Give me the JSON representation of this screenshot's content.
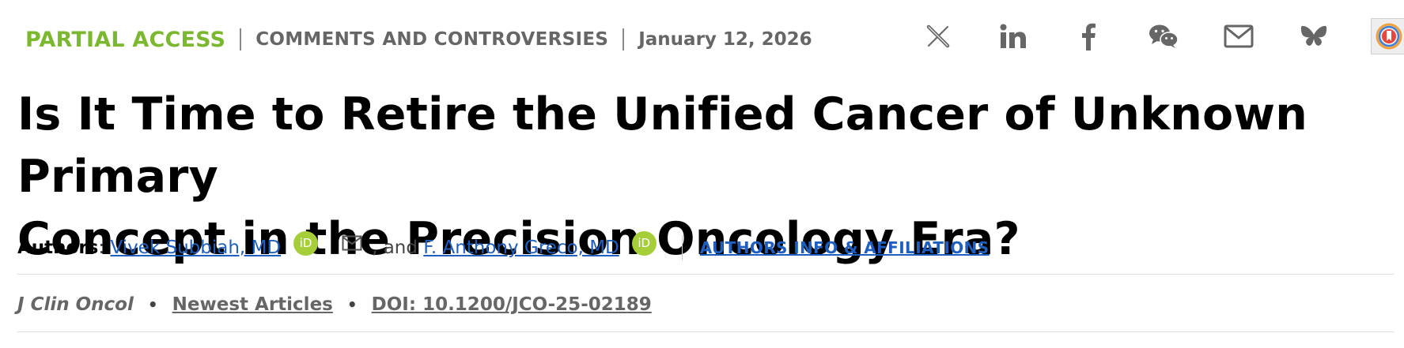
{
  "header": {
    "access_label": "PARTIAL ACCESS",
    "section_label": "COMMENTS AND CONTROVERSIES",
    "date": "January 12, 2026",
    "accent_color": "#7cb82f"
  },
  "share": [
    {
      "name": "x-icon"
    },
    {
      "name": "linkedin-icon"
    },
    {
      "name": "facebook-icon"
    },
    {
      "name": "wechat-icon"
    },
    {
      "name": "email-icon"
    },
    {
      "name": "bluesky-icon"
    },
    {
      "name": "altmetric-badge-icon"
    }
  ],
  "article": {
    "title_line1": "Is It Time to Retire the Unified Cancer of Unknown Primary",
    "title_line2": "Concept in the Precision Oncology Era?"
  },
  "authors": {
    "label": "Authors",
    "colon": ":",
    "author1": "Vivek Subbiah, MD",
    "conjunction": ", and",
    "author2": "F. Anthony Greco, MD",
    "orcid_text": "iD",
    "info_link": "AUTHORS INFO & AFFILIATIONS",
    "link_color": "#1f5fbf",
    "orcid_color": "#a6ce39"
  },
  "meta": {
    "journal": "J Clin Oncol",
    "bullet": "•",
    "collection": "Newest Articles",
    "doi": "DOI: 10.1200/JCO-25-02189"
  }
}
